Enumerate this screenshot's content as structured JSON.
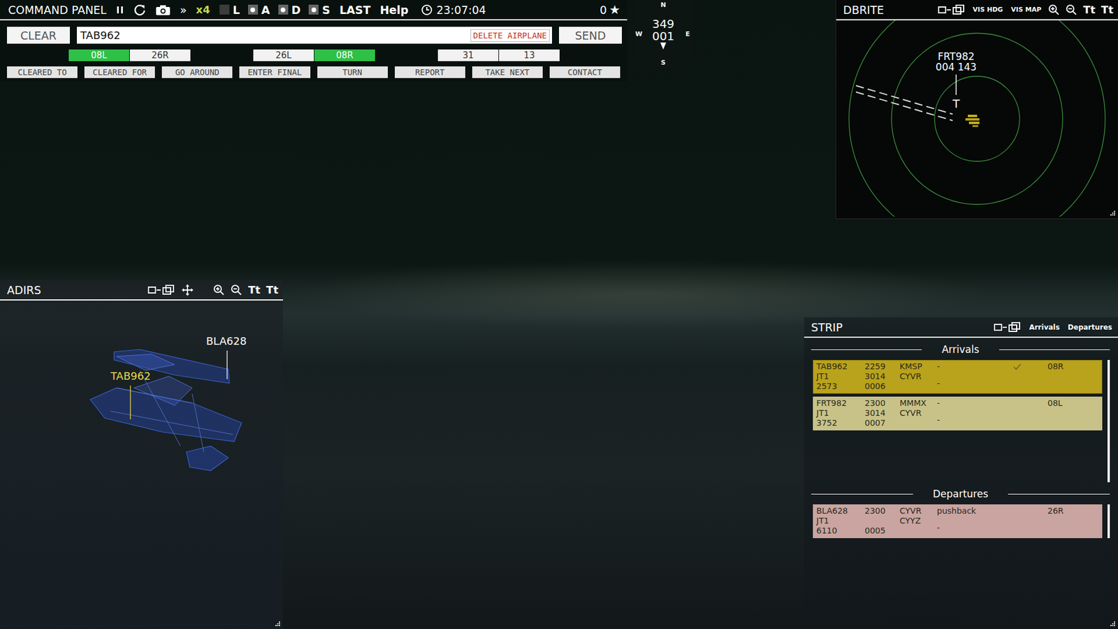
{
  "command_panel": {
    "title": "COMMAND PANEL",
    "fast_forward": "»",
    "speed": "x4",
    "toggles": [
      {
        "label": "L",
        "on": false
      },
      {
        "label": "A",
        "on": true
      },
      {
        "label": "D",
        "on": true
      },
      {
        "label": "S",
        "on": true
      }
    ],
    "last": "LAST",
    "help": "Help",
    "clock": "23:07:04",
    "score": "0",
    "score_icon": "★",
    "clear_button": "CLEAR",
    "input_value": "TAB962",
    "delete_button": "DELETE AIRPLANE",
    "send_button": "SEND",
    "runway_groups": [
      {
        "runways": [
          {
            "label": "08L",
            "selected": true
          },
          {
            "label": "26R",
            "selected": false
          }
        ]
      },
      {
        "runways": [
          {
            "label": "26L",
            "selected": false
          },
          {
            "label": "08R",
            "selected": true
          }
        ]
      },
      {
        "runways": [
          {
            "label": "31",
            "selected": false
          },
          {
            "label": "13",
            "selected": false
          }
        ]
      }
    ],
    "commands": [
      "CLEARED TO",
      "CLEARED FOR",
      "GO AROUND",
      "ENTER FINAL",
      "TURN",
      "REPORT",
      "TAKE NEXT",
      "CONTACT"
    ]
  },
  "compass": {
    "north": "N",
    "south": "S",
    "west": "W",
    "east": "E",
    "heading": "349",
    "wind": "001"
  },
  "dbrite": {
    "title": "DBRITE",
    "buttons": [
      "VIS HDG",
      "VIS MAP"
    ],
    "font_buttons": [
      "Tt",
      "Tt"
    ],
    "target": {
      "callsign": "FRT982",
      "data": "004 143",
      "marker": "T"
    }
  },
  "adirs": {
    "title": "ADIRS",
    "font_buttons": [
      "Tt",
      "Tt"
    ],
    "aircraft": [
      {
        "callsign": "BLA628",
        "selected": false
      },
      {
        "callsign": "TAB962",
        "selected": true
      }
    ]
  },
  "strip": {
    "title": "STRIP",
    "tabs": [
      "Arrivals",
      "Departures"
    ],
    "sections": [
      {
        "title": "Arrivals",
        "strips": [
          {
            "callsign": "TAB962",
            "type": "JT1",
            "squawk": "2573",
            "time": "2259",
            "code": "3014",
            "alt": "0006",
            "origin": "KMSP",
            "dest": "CYVR",
            "note": "-",
            "note2": "-",
            "checked": true,
            "runway": "08R",
            "selected": true,
            "color": "#b9a21c"
          },
          {
            "callsign": "FRT982",
            "type": "JT1",
            "squawk": "3752",
            "time": "2300",
            "code": "3014",
            "alt": "0007",
            "origin": "MMMX",
            "dest": "CYVR",
            "note": "-",
            "note2": "-",
            "checked": false,
            "runway": "08L",
            "selected": false,
            "color": "#c8c289"
          }
        ]
      },
      {
        "title": "Departures",
        "strips": [
          {
            "callsign": "BLA628",
            "type": "JT1",
            "squawk": "6110",
            "time": "2300",
            "alt": "0005",
            "origin": "CYVR",
            "dest": "CYYZ",
            "note": "pushback",
            "note2": "-",
            "checked": false,
            "runway": "26R",
            "selected": false,
            "color": "#c9a4a1"
          }
        ]
      }
    ]
  }
}
